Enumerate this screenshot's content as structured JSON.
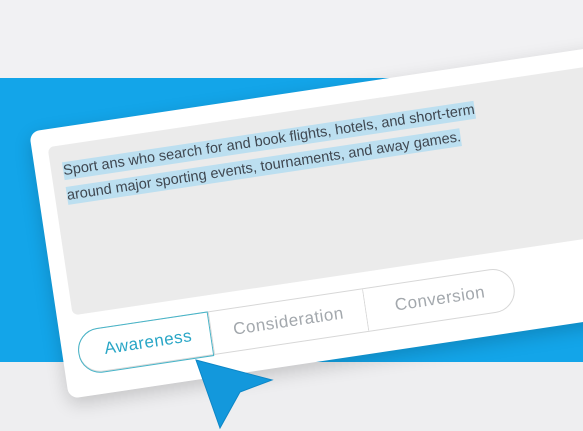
{
  "textarea": {
    "lines": [
      "Sport ans who search for and book flights, hotels, and short-term",
      "around major sporting events, tournaments, and away games."
    ]
  },
  "tabs": [
    {
      "label": "Awareness",
      "active": true
    },
    {
      "label": "Consideration",
      "active": false
    },
    {
      "label": "Conversion",
      "active": false
    }
  ],
  "colors": {
    "band": "#13a5e9",
    "highlight": "#bcdff0",
    "active_tab": "#29a6c6",
    "cursor": "#1398dc"
  },
  "icons": {
    "cursor": "pointer-arrow-icon"
  }
}
